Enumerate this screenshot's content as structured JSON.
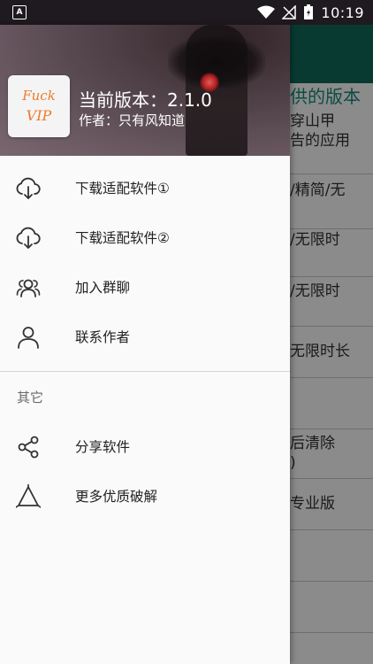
{
  "status_bar": {
    "time": "10:19",
    "left_icon": "A"
  },
  "drawer": {
    "header": {
      "logo_line1": "Fuck",
      "logo_line2": "VIP",
      "version": "当前版本：2.1.0",
      "author": "作者：只有风知道"
    },
    "items": [
      {
        "label": "下载适配软件①",
        "icon": "download-cloud-icon"
      },
      {
        "label": "下载适配软件②",
        "icon": "download-cloud-icon"
      },
      {
        "label": "加入群聊",
        "icon": "group-icon"
      },
      {
        "label": "联系作者",
        "icon": "person-icon"
      }
    ],
    "section_title": "其它",
    "other_items": [
      {
        "label": "分享软件",
        "icon": "share-icon"
      },
      {
        "label": "更多优质破解",
        "icon": "triangle-icon"
      }
    ]
  },
  "background": {
    "title": "供的版本",
    "rows": [
      "穿山甲",
      "告的应用",
      "/精简/无",
      "/无限时",
      "/无限时",
      "无限时长",
      "后清除",
      ")",
      "专业版"
    ]
  }
}
